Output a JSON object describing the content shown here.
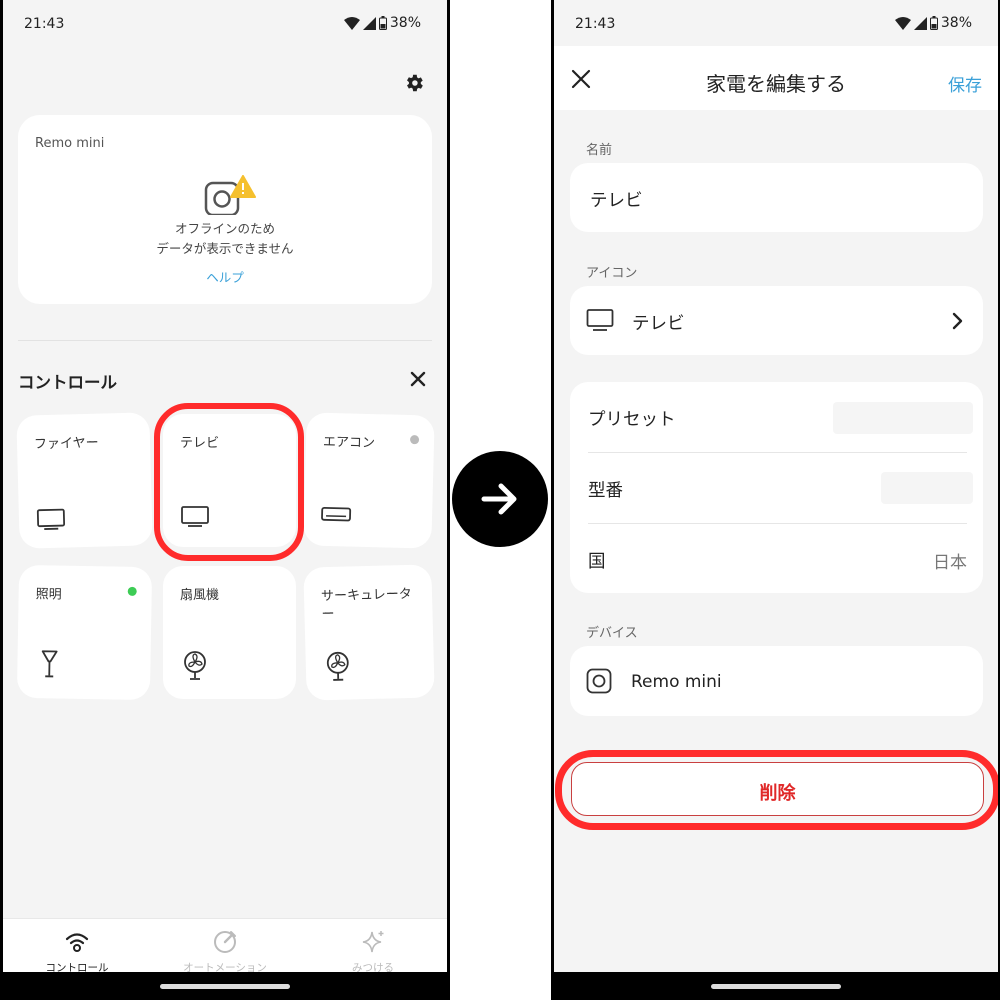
{
  "left": {
    "status": {
      "time": "21:43",
      "battery": "38%"
    },
    "hub": {
      "name": "Remo mini",
      "offline_line1": "オフラインのため",
      "offline_line2": "データが表示できません",
      "help": "ヘルプ"
    },
    "section_title": "コントロール",
    "tiles": [
      {
        "label": "ファイヤー",
        "icon": "tv-icon"
      },
      {
        "label": "テレビ",
        "icon": "tv-icon"
      },
      {
        "label": "エアコン",
        "icon": "air-conditioner-icon",
        "dot_color": "#bbbbbb"
      },
      {
        "label": "照明",
        "icon": "lamp-icon",
        "dot_color": "#3dcc55"
      },
      {
        "label": "扇風機",
        "icon": "fan-icon"
      },
      {
        "label": "サーキュレーター",
        "icon": "fan-icon"
      }
    ],
    "nav": [
      {
        "label": "コントロール",
        "icon": "wifi-icon",
        "active": true
      },
      {
        "label": "オートメーション",
        "icon": "automation-icon",
        "active": false
      },
      {
        "label": "みつける",
        "icon": "sparkle-icon",
        "active": false
      }
    ]
  },
  "right": {
    "status": {
      "time": "21:43",
      "battery": "38%"
    },
    "header": {
      "title": "家電を編集する",
      "save": "保存"
    },
    "name_label": "名前",
    "name_value": "テレビ",
    "icon_label": "アイコン",
    "icon_value": "テレビ",
    "rows": [
      {
        "label": "プリセット",
        "value": ""
      },
      {
        "label": "型番",
        "value": ""
      },
      {
        "label": "国",
        "value": "日本"
      }
    ],
    "device_label": "デバイス",
    "device_value": "Remo mini",
    "delete": "削除"
  },
  "colors": {
    "accent": "#3aa0d8",
    "highlight": "#ff2b2b",
    "delete": "#e02828"
  }
}
